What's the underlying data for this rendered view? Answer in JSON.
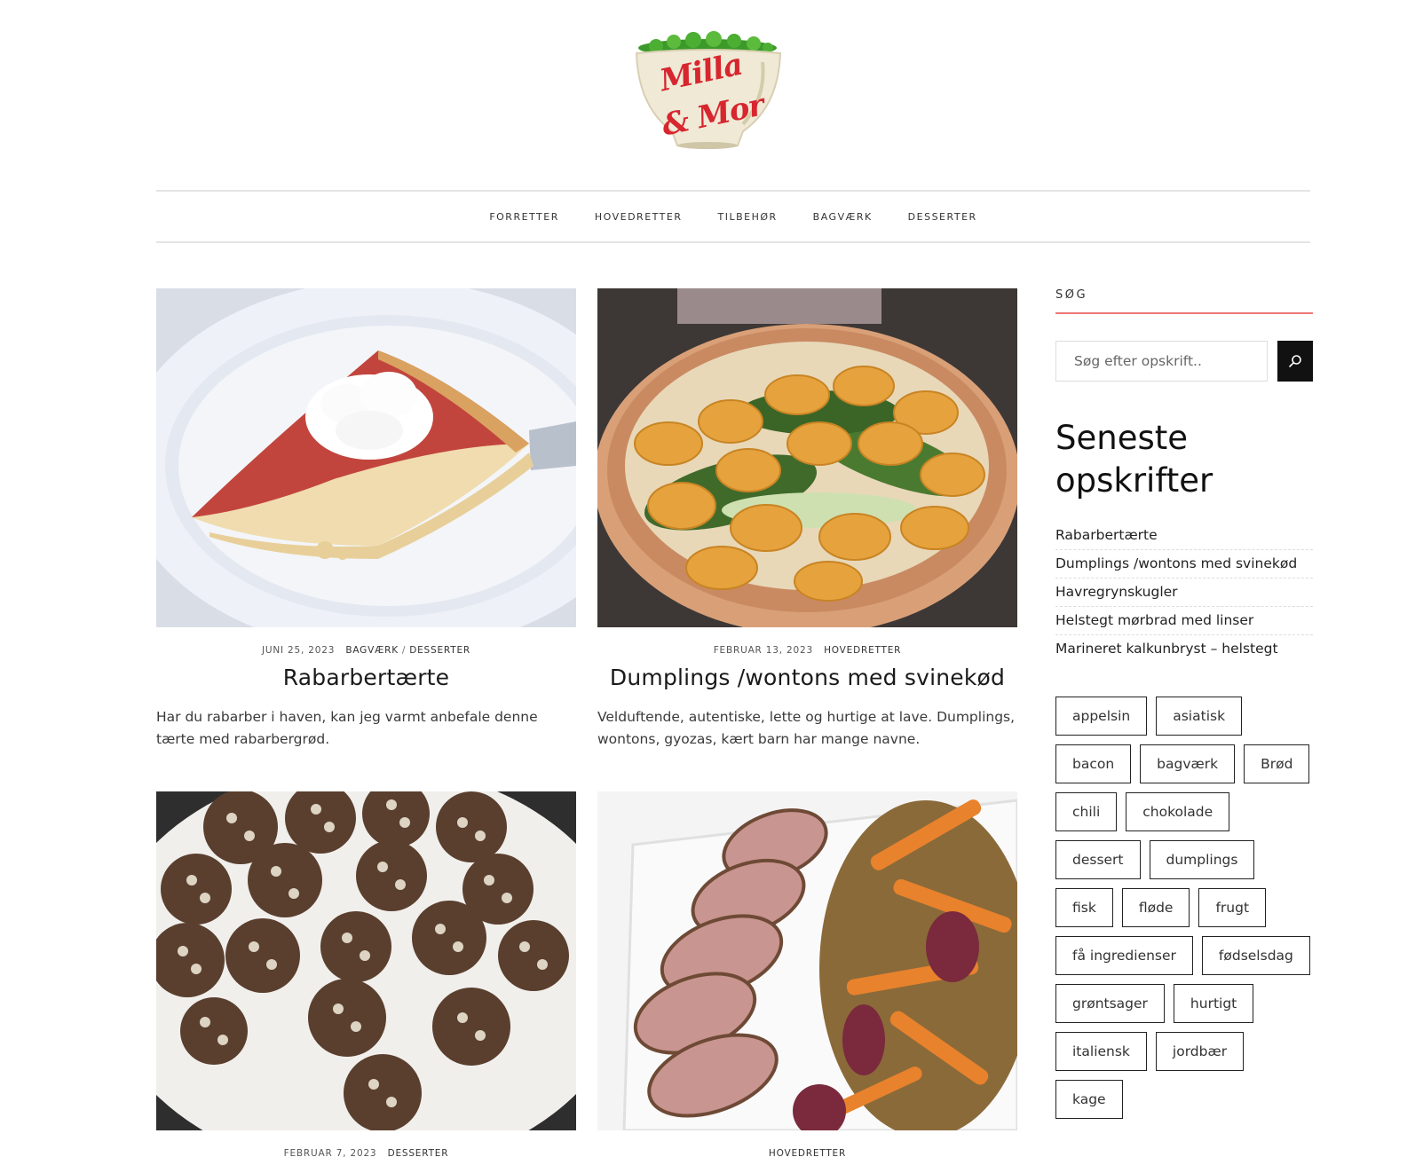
{
  "site": {
    "logo_line1": "Milla",
    "logo_line2": "& Mor"
  },
  "nav": {
    "items": [
      "FORRETTER",
      "HOVEDRETTER",
      "TILBEHØR",
      "BAGVÆRK",
      "DESSERTER"
    ]
  },
  "posts": [
    {
      "date": "JUNI 25, 2023",
      "categories": [
        "BAGVÆRK",
        "DESSERTER"
      ],
      "title": "Rabarbertærte",
      "excerpt": "Har du rabarber i haven, kan jeg varmt anbefale denne tærte med rabarbergrød."
    },
    {
      "date": "FEBRUAR 13, 2023",
      "categories": [
        "HOVEDRETTER"
      ],
      "title": "Dumplings /wontons med svinekød",
      "excerpt": "Velduftende, autentiske, lette og hurtige at lave. Dumplings, wontons, gyozas, kært barn har mange navne."
    },
    {
      "date": "FEBRUAR 7, 2023",
      "categories": [
        "DESSERTER"
      ],
      "title": "",
      "excerpt": ""
    },
    {
      "date": "",
      "categories": [
        "HOVEDRETTER"
      ],
      "title": "",
      "excerpt": ""
    }
  ],
  "sidebar": {
    "search_title": "SØG",
    "search_placeholder": "Søg efter opskrift..",
    "recent_title": "Seneste opskrifter",
    "recent": [
      "Rabarbertærte",
      "Dumplings /wontons med svinekød",
      "Havregrynskugler",
      "Helstegt mørbrad med linser",
      "Marineret kalkunbryst – helstegt"
    ],
    "tags": [
      "appelsin",
      "asiatisk",
      "bacon",
      "bagværk",
      "Brød",
      "chili",
      "chokolade",
      "dessert",
      "dumplings",
      "fisk",
      "fløde",
      "frugt",
      "få ingredienser",
      "fødselsdag",
      "grøntsager",
      "hurtigt",
      "italiensk",
      "jordbær",
      "kage"
    ]
  },
  "icons": {
    "search": "search-icon"
  },
  "colors": {
    "accent": "#e77777",
    "logo_red": "#d7262e",
    "button_dark": "#111111"
  }
}
